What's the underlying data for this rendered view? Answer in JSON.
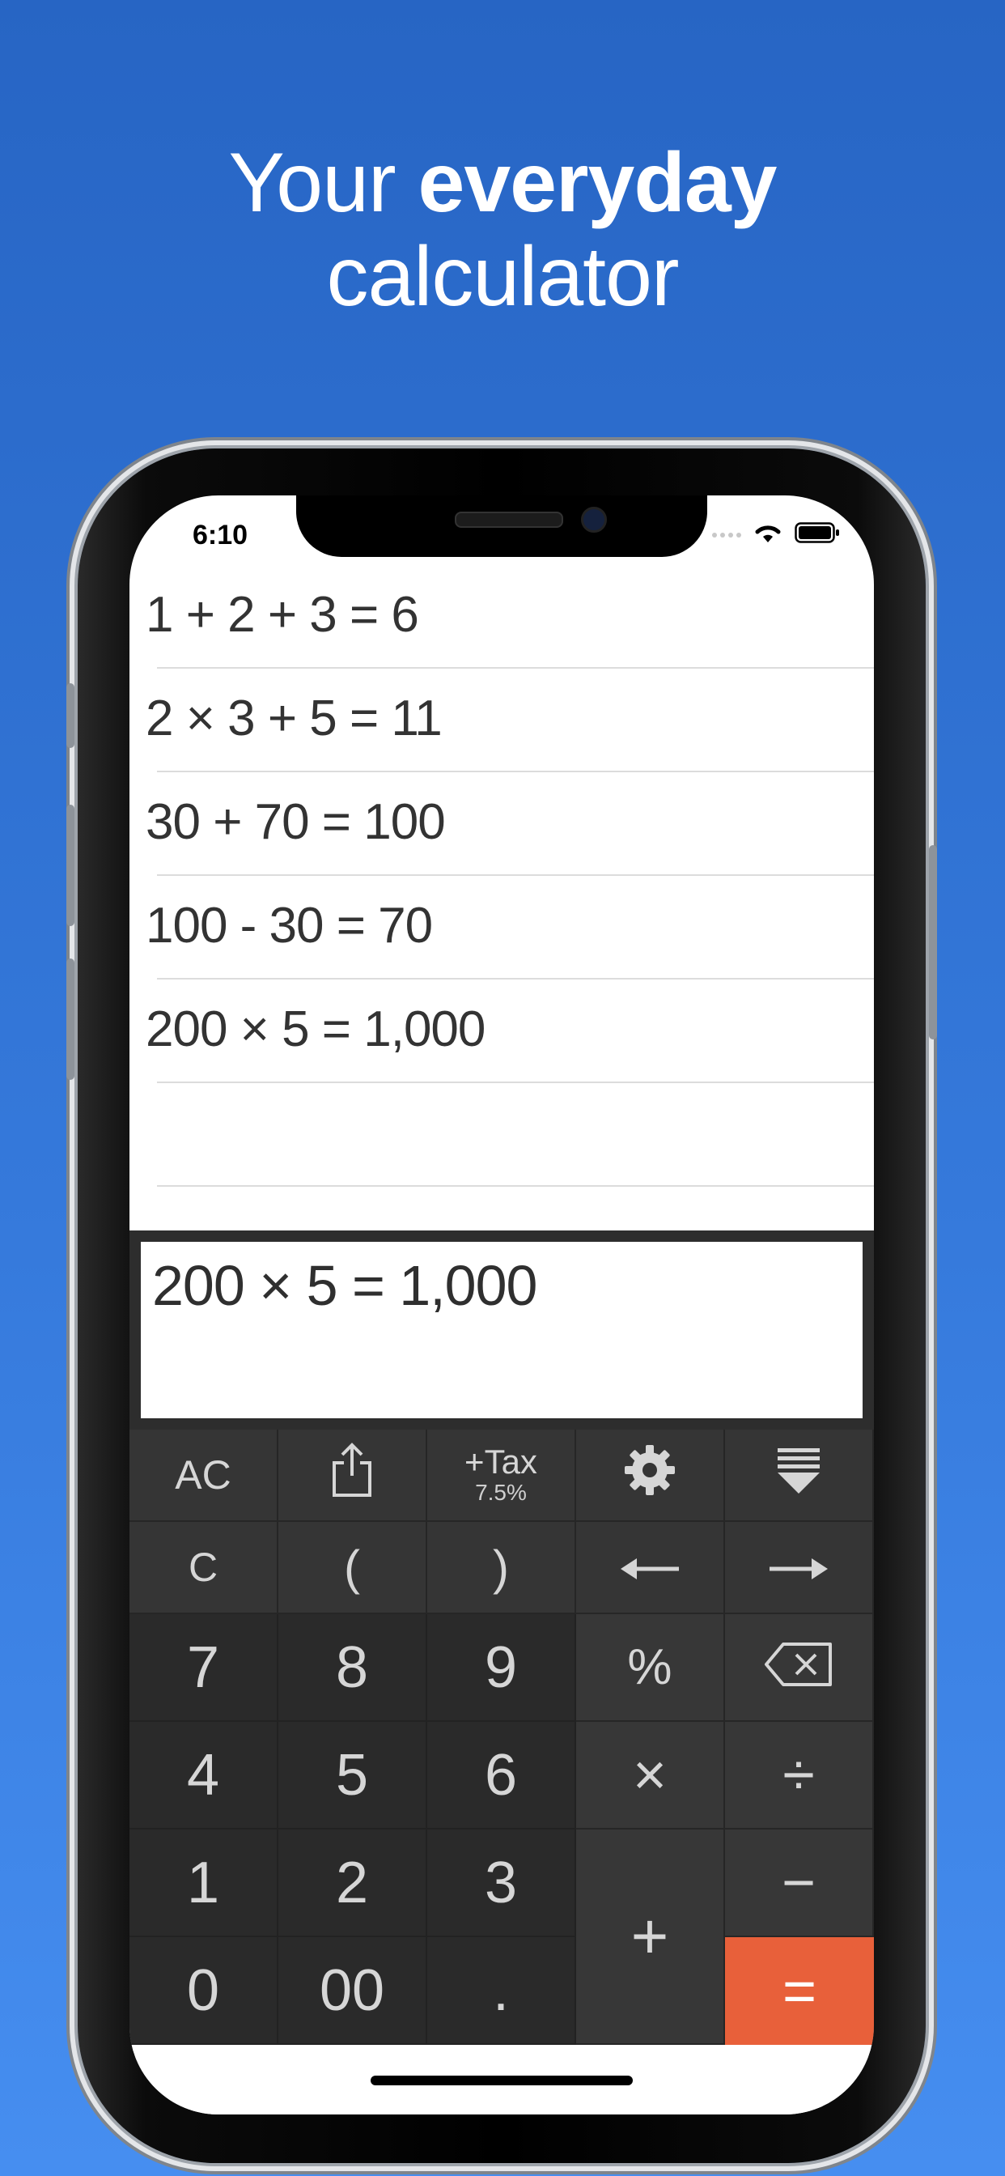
{
  "headline": {
    "line1_regular": "Your ",
    "line1_bold": "everyday",
    "line2": "calculator"
  },
  "status_bar": {
    "time": "6:10",
    "icons": [
      "signal-dots-icon",
      "wifi-icon",
      "battery-icon"
    ]
  },
  "history": [
    "1 + 2 + 3 = 6",
    "2 × 3 + 5 = 11",
    "30 + 70 = 100",
    "100 - 30 = 70",
    "200 × 5 = 1,000",
    ""
  ],
  "display": {
    "expression": "200 × 5 = 1,000"
  },
  "keys": {
    "ac": "AC",
    "share_icon": "share-icon",
    "tax_label": "+Tax",
    "tax_rate": "7.5%",
    "settings_icon": "gear-icon",
    "collapse_icon": "collapse-icon",
    "c": "C",
    "paren_open": "(",
    "paren_close": ")",
    "left_arrow_icon": "left-arrow-icon",
    "right_arrow_icon": "right-arrow-icon",
    "d7": "7",
    "d8": "8",
    "d9": "9",
    "percent": "%",
    "backspace_icon": "backspace-icon",
    "d4": "4",
    "d5": "5",
    "d6": "6",
    "multiply": "×",
    "divide": "÷",
    "d1": "1",
    "d2": "2",
    "d3": "3",
    "plus": "+",
    "minus": "−",
    "d0": "0",
    "d00": "00",
    "dot": ".",
    "equals": "="
  },
  "colors": {
    "background_top": "#2765c4",
    "background_bottom": "#468ef0",
    "equals_key": "#e8603a",
    "keypad": "#2a2a2a"
  }
}
